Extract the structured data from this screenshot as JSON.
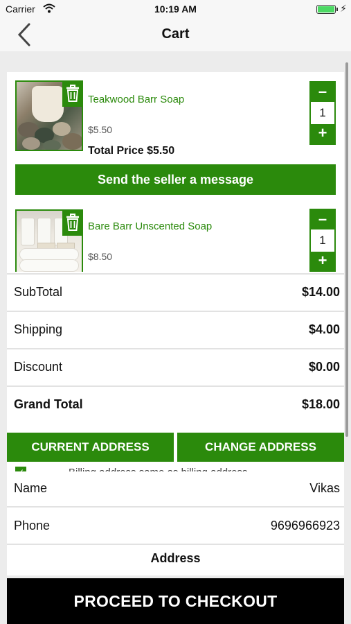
{
  "status_bar": {
    "carrier": "Carrier",
    "time": "10:19 AM"
  },
  "nav": {
    "title": "Cart",
    "back_icon": "chevron-left-icon"
  },
  "items": [
    {
      "name": "Teakwood Barr Soap",
      "price": "$5.50",
      "total": "Total Price $5.50",
      "quantity": "1"
    },
    {
      "name": "Bare Barr Unscented Soap",
      "price": "$8.50",
      "quantity": "1"
    }
  ],
  "stepper": {
    "minus": "–",
    "plus": "+"
  },
  "message_button": "Send the seller a message",
  "summary": [
    {
      "label": "SubTotal",
      "value": "$14.00"
    },
    {
      "label": "Shipping",
      "value": "$4.00"
    },
    {
      "label": "Discount",
      "value": "$0.00"
    },
    {
      "label": "Grand Total",
      "value": "$18.00"
    }
  ],
  "address_buttons": {
    "current": "CURRENT ADDRESS",
    "change": "CHANGE ADDRESS"
  },
  "billing": {
    "checked": true,
    "text": "Billing address same as billing address"
  },
  "info": {
    "name_label": "Name",
    "name_value": "Vikas",
    "phone_label": "Phone",
    "phone_value": "9696966923",
    "address_label": "Address"
  },
  "checkout_button": "PROCEED TO CHECKOUT",
  "colors": {
    "accent": "#2b8a0c",
    "checkout": "#000000",
    "background": "#ececec"
  }
}
